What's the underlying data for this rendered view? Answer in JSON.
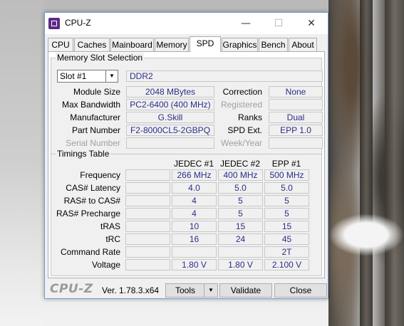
{
  "window": {
    "title": "CPU-Z"
  },
  "titlebar_buttons": {
    "minimize": "—",
    "maximize": "☐",
    "close": "✕"
  },
  "tabs": [
    {
      "label": "CPU"
    },
    {
      "label": "Caches"
    },
    {
      "label": "Mainboard"
    },
    {
      "label": "Memory"
    },
    {
      "label": "SPD"
    },
    {
      "label": "Graphics"
    },
    {
      "label": "Bench"
    },
    {
      "label": "About"
    }
  ],
  "active_tab": "SPD",
  "slot": {
    "title": "Memory Slot Selection",
    "selected": "Slot #1",
    "type": "DDR2",
    "module_size_label": "Module Size",
    "module_size": "2048 MBytes",
    "max_bandwidth_label": "Max Bandwidth",
    "max_bandwidth": "PC2-6400 (400 MHz)",
    "manufacturer_label": "Manufacturer",
    "manufacturer": "G.Skill",
    "part_number_label": "Part Number",
    "part_number": "F2-8000CL5-2GBPQ",
    "serial_number_label": "Serial Number",
    "serial_number": "",
    "correction_label": "Correction",
    "correction": "None",
    "registered_label": "Registered",
    "registered": "",
    "ranks_label": "Ranks",
    "ranks": "Dual",
    "spd_ext_label": "SPD Ext.",
    "spd_ext": "EPP 1.0",
    "week_year_label": "Week/Year",
    "week_year": ""
  },
  "timings": {
    "title": "Timings Table",
    "columns": [
      "JEDEC #1",
      "JEDEC #2",
      "EPP #1"
    ],
    "rows": [
      {
        "label": "Frequency",
        "values": [
          "266 MHz",
          "400 MHz",
          "500 MHz"
        ]
      },
      {
        "label": "CAS# Latency",
        "values": [
          "4.0",
          "5.0",
          "5.0"
        ]
      },
      {
        "label": "RAS# to CAS#",
        "values": [
          "4",
          "5",
          "5"
        ]
      },
      {
        "label": "RAS# Precharge",
        "values": [
          "4",
          "5",
          "5"
        ]
      },
      {
        "label": "tRAS",
        "values": [
          "10",
          "15",
          "15"
        ]
      },
      {
        "label": "tRC",
        "values": [
          "16",
          "24",
          "45"
        ]
      },
      {
        "label": "Command Rate",
        "values": [
          "",
          "",
          "2T"
        ]
      },
      {
        "label": "Voltage",
        "values": [
          "1.80 V",
          "1.80 V",
          "2.100 V"
        ]
      }
    ]
  },
  "footer": {
    "brand": "CPU-Z",
    "version": "Ver. 1.78.3.x64",
    "tools": "Tools",
    "validate": "Validate",
    "close": "Close"
  },
  "colors": {
    "value_text": "#2c2c8a",
    "window_border": "#6f9fd8",
    "brand_gray": "#9a9a9a"
  }
}
